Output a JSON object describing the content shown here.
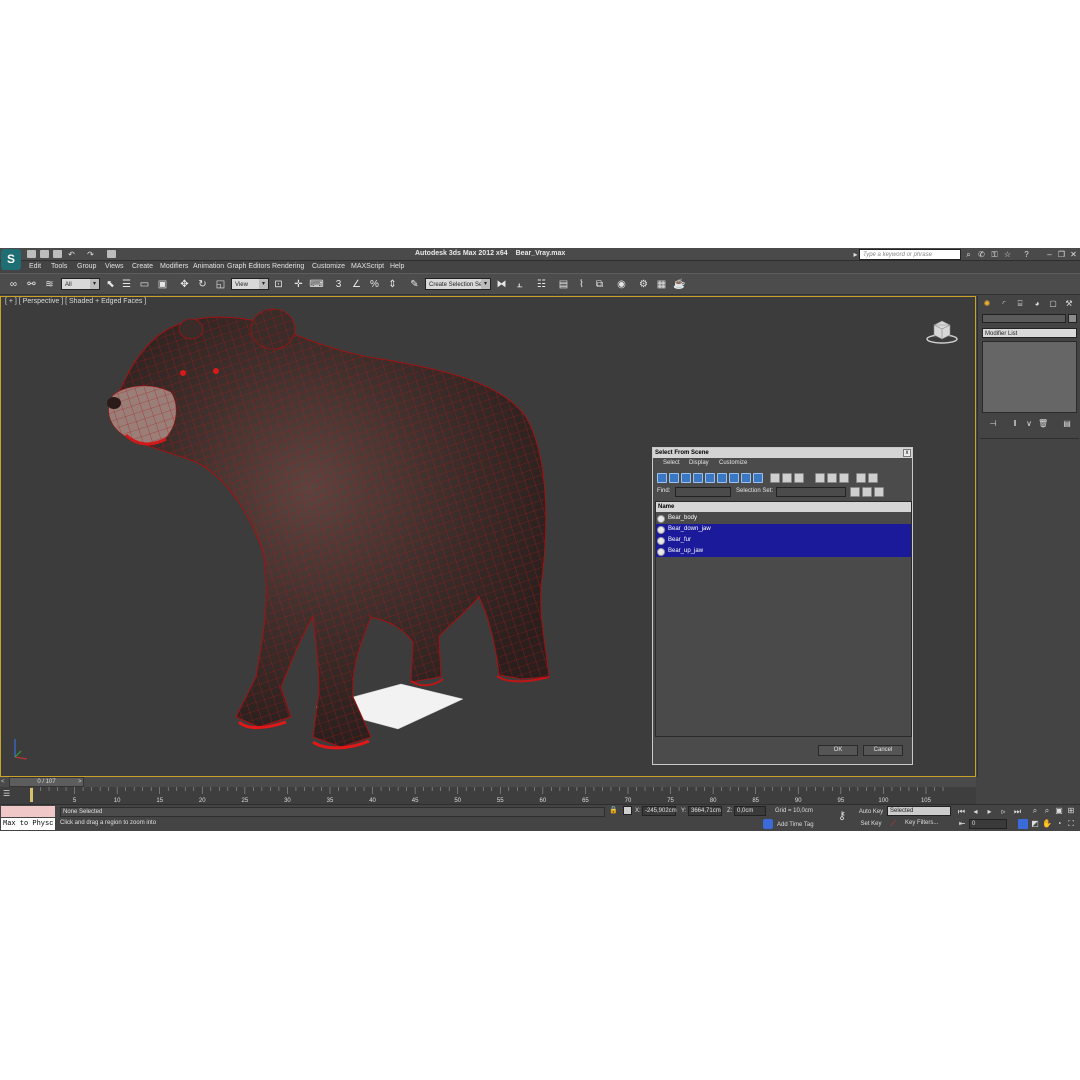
{
  "title": {
    "app": "Autodesk 3ds Max  2012 x64",
    "file": "Bear_Vray.max",
    "search_placeholder": "Type a keyword or phrase"
  },
  "menu": [
    "Edit",
    "Tools",
    "Group",
    "Views",
    "Create",
    "Modifiers",
    "Animation",
    "Graph Editors",
    "Rendering",
    "Customize",
    "MAXScript",
    "Help"
  ],
  "toolbar": {
    "selection_filter": "All",
    "ref_coord": "View",
    "named_selection": "Create Selection Se",
    "snap_label": "3"
  },
  "viewport": {
    "label": "[ + ] [ Perspective ] [ Shaded + Edged Faces ]"
  },
  "dialog": {
    "title": "Select From Scene",
    "close": "x",
    "menu": [
      "Select",
      "Display",
      "Customize"
    ],
    "find_label": "Find:",
    "selection_set_label": "Selection Set:",
    "column_name": "Name",
    "items": [
      {
        "name": "Bear_body",
        "selected": false
      },
      {
        "name": "Bear_down_jaw",
        "selected": true
      },
      {
        "name": "Bear_fur",
        "selected": true
      },
      {
        "name": "Bear_up_jaw",
        "selected": true
      }
    ],
    "ok": "OK",
    "cancel": "Cancel"
  },
  "command_panel": {
    "modifier_list": "Modifier List"
  },
  "time_slider": {
    "position": "0 / 107",
    "left": "<",
    "right": ">"
  },
  "ruler": {
    "ticks": [
      5,
      10,
      15,
      20,
      25,
      30,
      35,
      40,
      45,
      50,
      55,
      60,
      65,
      70,
      75,
      80,
      85,
      90,
      95,
      100,
      105
    ],
    "max_frame": 107
  },
  "status": {
    "maxscript": "Max to Physc",
    "selection": "None Selected",
    "prompt": "Click and drag a region to zoom into",
    "x_label": "X:",
    "x_value": "-245,902cm",
    "y_label": "Y:",
    "y_value": "3664,71cm",
    "z_label": "Z:",
    "z_value": "0,0cm",
    "grid": "Grid = 10,0cm",
    "add_time_tag": "Add Time Tag",
    "auto_key": "Auto Key",
    "set_key": "Set Key",
    "selected_combo": "Selected",
    "key_filters": "Key Filters...",
    "frame": "0"
  },
  "colors": {
    "viewport_border": "#c9a227",
    "selection": "#1a1a9a",
    "app_logo": "#1f6e74"
  }
}
